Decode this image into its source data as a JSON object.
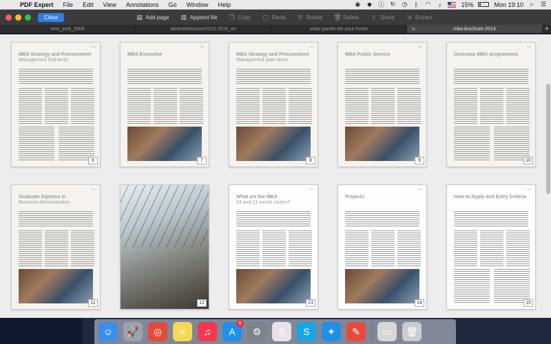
{
  "menubar": {
    "apple": "",
    "items": [
      "PDF Expert",
      "File",
      "Edit",
      "View",
      "Annotations",
      "Go",
      "Window",
      "Help"
    ],
    "battery": "15%",
    "clock": "Mon 19:10"
  },
  "toolbar": {
    "close_label": "Close",
    "tools": [
      {
        "label": "Add page",
        "icon": "add-page-icon",
        "glyph": "▤",
        "enabled": true
      },
      {
        "label": "Append file",
        "icon": "append-file-icon",
        "glyph": "▥",
        "enabled": true
      },
      {
        "label": "Copy",
        "icon": "copy-icon",
        "glyph": "❐",
        "enabled": false
      },
      {
        "label": "Paste",
        "icon": "paste-icon",
        "glyph": "▢",
        "enabled": false
      },
      {
        "label": "Rotate",
        "icon": "rotate-icon",
        "glyph": "↻",
        "enabled": false
      },
      {
        "label": "Delete",
        "icon": "delete-icon",
        "glyph": "🗑",
        "enabled": false
      },
      {
        "label": "Share",
        "icon": "share-icon",
        "glyph": "⇪",
        "enabled": false
      },
      {
        "label": "Extract",
        "icon": "extract-icon",
        "glyph": "⇲",
        "enabled": false
      }
    ]
  },
  "tabs": [
    "new_york_2008",
    "wintererlebnisse2015-2016_en",
    "solar-panels-for-your-home",
    "mba-brochure-2014"
  ],
  "active_tab": 3,
  "pages": [
    {
      "num": "6",
      "title": "MBA Strategy and Procurement",
      "subtitle": "Management (full-time)"
    },
    {
      "num": "7",
      "title": "MBA Executive",
      "subtitle": ""
    },
    {
      "num": "8",
      "title": "MBA Strategy and Procurement",
      "subtitle": "Management (part-time)"
    },
    {
      "num": "9",
      "title": "MBA Public Service",
      "subtitle": ""
    },
    {
      "num": "10",
      "title": "Overseas MBA programmes",
      "subtitle": ""
    },
    {
      "num": "11",
      "title": "Graduate Diploma in",
      "subtitle": "Business Administration"
    },
    {
      "num": "12",
      "title": "",
      "subtitle": ""
    },
    {
      "num": "13",
      "title": "What are the MBA",
      "subtitle": "24 and 21 month routes?"
    },
    {
      "num": "14",
      "title": "Projects",
      "subtitle": ""
    },
    {
      "num": "15",
      "title": "How to Apply and Entry Criteria",
      "subtitle": ""
    }
  ],
  "dock": [
    {
      "name": "finder-icon",
      "glyph": "☺",
      "color": "#3d8ee8"
    },
    {
      "name": "launchpad-icon",
      "glyph": "🚀",
      "color": "#9aa3ad"
    },
    {
      "name": "chrome-icon",
      "glyph": "◎",
      "color": "#e5493a"
    },
    {
      "name": "notes-icon",
      "glyph": "≡",
      "color": "#f6d757"
    },
    {
      "name": "music-icon",
      "glyph": "♫",
      "color": "#f2394f"
    },
    {
      "name": "app-store-icon",
      "glyph": "A",
      "color": "#1f8ff0",
      "badge": "5"
    },
    {
      "name": "system-preferences-icon",
      "glyph": "⚙",
      "color": "#7e838b"
    },
    {
      "name": "slack-icon",
      "glyph": "S",
      "color": "#e8e2e6"
    },
    {
      "name": "skype-icon",
      "glyph": "S",
      "color": "#1aa4e8"
    },
    {
      "name": "safari-icon",
      "glyph": "✦",
      "color": "#1e90e6"
    },
    {
      "name": "pdf-expert-icon",
      "glyph": "✎",
      "color": "#e84b3c"
    },
    {
      "name": "sep",
      "glyph": "",
      "color": ""
    },
    {
      "name": "preview-icon",
      "glyph": "▭",
      "color": "#d7d7d7"
    },
    {
      "name": "trash-icon",
      "glyph": "🗑",
      "color": "#c9cdd2"
    }
  ]
}
